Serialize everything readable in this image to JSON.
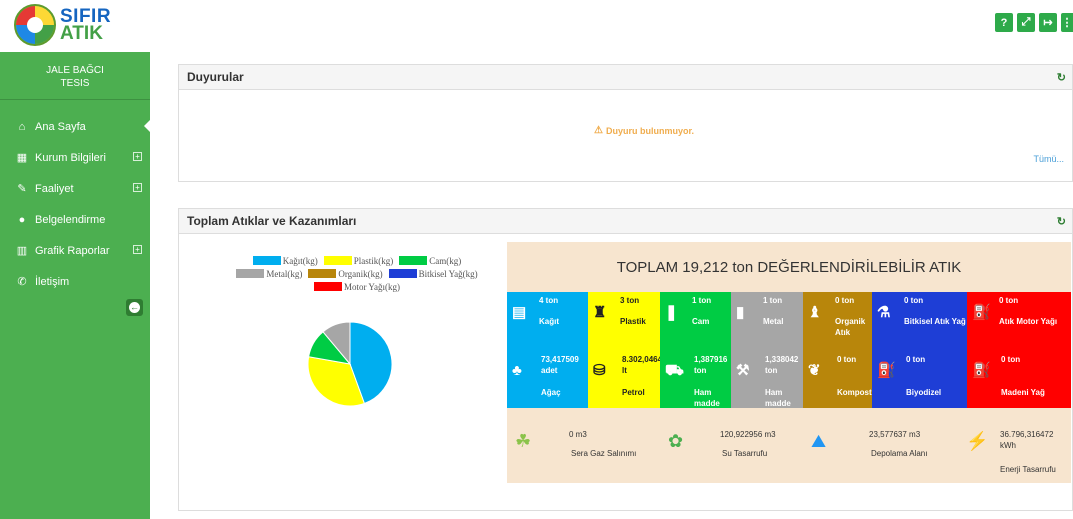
{
  "brand": {
    "line1": "SIFIR",
    "line2": "ATIK"
  },
  "top_buttons": [
    {
      "name": "help-button",
      "glyph": "?"
    },
    {
      "name": "fullscreen-button",
      "glyph": "⤢"
    },
    {
      "name": "logout-button",
      "glyph": "↦"
    },
    {
      "name": "more-button",
      "glyph": "⋮"
    }
  ],
  "user": {
    "name": "JALE BAĞCI",
    "role": "TESIS"
  },
  "menu": [
    {
      "label": "Ana Sayfa",
      "icon": "home-icon",
      "glyph": "⌂",
      "expandable": false,
      "active": true
    },
    {
      "label": "Kurum Bilgileri",
      "icon": "building-icon",
      "glyph": "▦",
      "expandable": true,
      "active": false
    },
    {
      "label": "Faaliyet",
      "icon": "edit-icon",
      "glyph": "✎",
      "expandable": true,
      "active": false
    },
    {
      "label": "Belgelendirme",
      "icon": "certificate-icon",
      "glyph": "●",
      "expandable": false,
      "active": false
    },
    {
      "label": "Grafik Raporlar",
      "icon": "bar-chart-icon",
      "glyph": "▥",
      "expandable": true,
      "active": false
    },
    {
      "label": "İletişim",
      "icon": "phone-icon",
      "glyph": "✆",
      "expandable": false,
      "active": false
    }
  ],
  "collapse_glyph": "←",
  "announcements": {
    "title": "Duyurular",
    "empty_message": "Duyuru bulunmuyor.",
    "all_link": "Tümü..."
  },
  "totals": {
    "title": "Toplam Atıklar ve Kazanımları",
    "legend": [
      {
        "label": "Kağıt(kg)",
        "color": "#00aeef"
      },
      {
        "label": "Plastik(kg)",
        "color": "#ffff00"
      },
      {
        "label": "Cam(kg)",
        "color": "#00cc44"
      },
      {
        "label": "Metal(kg)",
        "color": "#a6a6a6"
      },
      {
        "label": "Organik(kg)",
        "color": "#b8860b"
      },
      {
        "label": "Bitkisel Yağ(kg)",
        "color": "#1e3ed6"
      },
      {
        "label": "Motor Yağı(kg)",
        "color": "#ff0000"
      }
    ],
    "pie": [
      {
        "label": "Kağıt(kg)",
        "value": 4,
        "color": "#00aeef"
      },
      {
        "label": "Plastik(kg)",
        "value": 3,
        "color": "#ffff00"
      },
      {
        "label": "Cam(kg)",
        "value": 1,
        "color": "#00cc44"
      },
      {
        "label": "Metal(kg)",
        "value": 1,
        "color": "#a6a6a6"
      }
    ],
    "headline": "TOPLAM 19,212 ton DEĞERLENDİRİLEBİLİR ATIK",
    "waste_cells": [
      {
        "value": "4 ton",
        "name": "Kağıt",
        "bg": "#00aeef",
        "icon": "paper-icon",
        "glyph": "▤"
      },
      {
        "value": "3 ton",
        "name": "Plastik",
        "bg": "#ffff00",
        "icon": "plastic-bottle-icon",
        "glyph": "♜",
        "dark": true
      },
      {
        "value": "1 ton",
        "name": "Cam",
        "bg": "#00cc44",
        "icon": "glass-bottle-icon",
        "glyph": "❚"
      },
      {
        "value": "1 ton",
        "name": "Metal",
        "bg": "#a6a6a6",
        "icon": "metal-can-icon",
        "glyph": "▮"
      },
      {
        "value": "0 ton",
        "name": "Organik Atık",
        "bg": "#b8860b",
        "icon": "organic-waste-icon",
        "glyph": "♝"
      },
      {
        "value": "0 ton",
        "name": "Bitkisel Atık Yağ",
        "bg": "#1e3ed6",
        "icon": "vegetable-oil-icon",
        "glyph": "⚗"
      },
      {
        "value": "0 ton",
        "name": "Atık Motor Yağı",
        "bg": "#ff0000",
        "icon": "motor-oil-icon",
        "glyph": "⛽"
      }
    ],
    "gain_cells": [
      {
        "value": "73,417509",
        "unit": "adet",
        "name": "Ağaç",
        "bg": "#00aeef",
        "icon": "tree-icon",
        "glyph": "♣"
      },
      {
        "value": "8.302,0464",
        "unit": "lt",
        "name": "Petrol",
        "bg": "#ffff00",
        "icon": "oil-barrel-icon",
        "glyph": "⛁",
        "dark": true
      },
      {
        "value": "1,387916",
        "unit": "ton",
        "name": "Ham madde",
        "bg": "#00cc44",
        "icon": "mine-cart-icon",
        "glyph": "⛟"
      },
      {
        "value": "1,338042",
        "unit": "ton",
        "name": "Ham madde",
        "bg": "#a6a6a6",
        "icon": "anvil-icon",
        "glyph": "⚒"
      },
      {
        "value": "0 ton",
        "unit": "",
        "name": "Kompost",
        "bg": "#b8860b",
        "icon": "sprout-icon",
        "glyph": "❦"
      },
      {
        "value": "0 ton",
        "unit": "",
        "name": "Biyodizel",
        "bg": "#1e3ed6",
        "icon": "fuel-pump-icon",
        "glyph": "⛽"
      },
      {
        "value": "0 ton",
        "unit": "",
        "name": "Madeni Yağ",
        "bg": "#ff0000",
        "icon": "oil-can-icon",
        "glyph": "⛽"
      }
    ],
    "savings": [
      {
        "value": "0 m3",
        "name": "Sera Gaz Salınımı",
        "icon": "footprints-icon",
        "glyph": "☘",
        "color": "#8bc34a"
      },
      {
        "value": "120,922956 m3",
        "name": "Su Tasarrufu",
        "icon": "water-drop-leaf-icon",
        "glyph": "✿",
        "color": "#4caf50"
      },
      {
        "value": "23,577637 m3",
        "name": "Depolama Alanı",
        "icon": "landfill-icon",
        "glyph": "⛰",
        "color": "#2196f3"
      },
      {
        "value": "36.796,316472",
        "unit": "kWh",
        "name": "Enerji Tasarrufu",
        "icon": "plug-icon",
        "glyph": "⚡",
        "color": "#4caf50"
      }
    ]
  }
}
